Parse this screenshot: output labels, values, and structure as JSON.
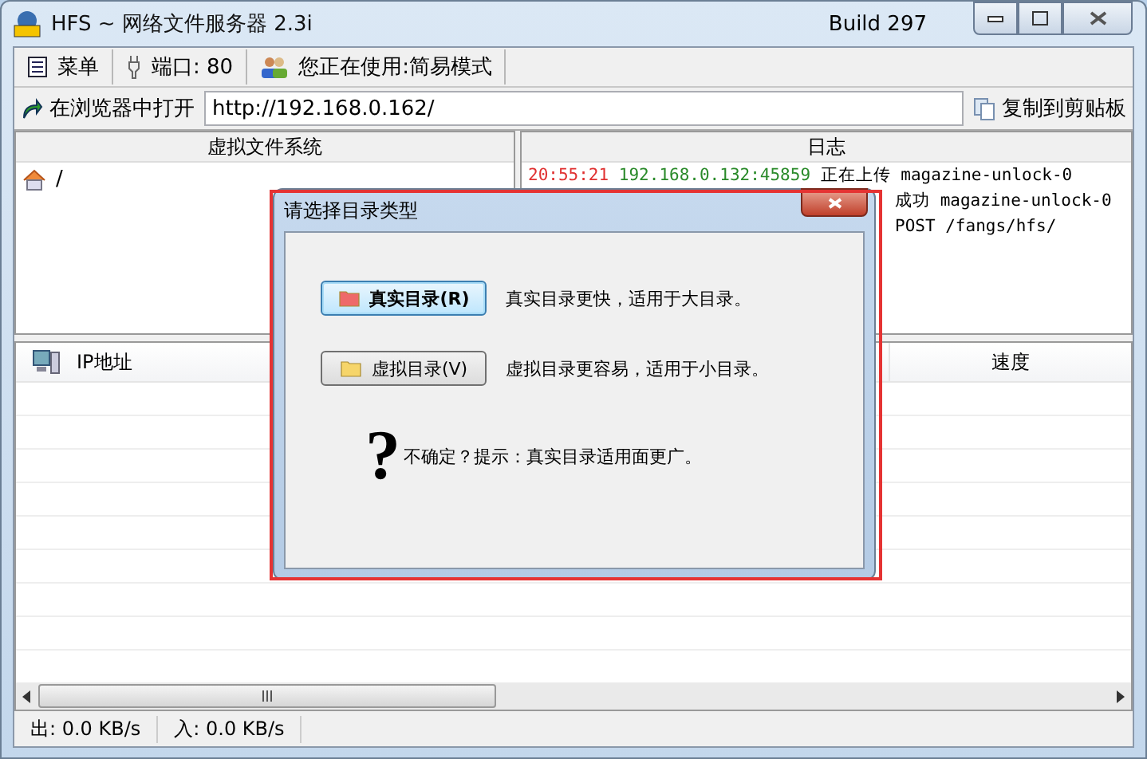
{
  "window": {
    "title": "HFS ~ 网络文件服务器 2.3i",
    "build": "Build 297"
  },
  "toolbar": [
    {
      "kind": "menu",
      "label": "菜单"
    },
    {
      "kind": "port",
      "label": "端口: 80"
    },
    {
      "kind": "mode",
      "label": "您正在使用:简易模式"
    }
  ],
  "url_bar": {
    "open_label": "在浏览器中打开",
    "url": "http://192.168.0.162/",
    "copy_label": "复制到剪贴板"
  },
  "vfs": {
    "header": "虚拟文件系统",
    "items": [
      {
        "label": "/"
      }
    ]
  },
  "log": {
    "header": "日志",
    "lines": [
      {
        "kind": "full",
        "time": "20:55:21",
        "address": "192.168.0.132:45859",
        "text": "正在上传 magazine-unlock-0"
      },
      {
        "kind": "partial",
        "text": "成功 magazine-unlock-0"
      },
      {
        "kind": "partial",
        "text": "POST /fangs/hfs/"
      }
    ]
  },
  "connections": {
    "columns": [
      "IP地址",
      "速度"
    ]
  },
  "status_bar": [
    "出: 0.0 KB/s",
    "入: 0.0 KB/s"
  ],
  "dialog": {
    "title": "请选择目录类型",
    "options": [
      {
        "kind": "real",
        "button": "真实目录(R)",
        "description": "真实目录更快，适用于大目录。",
        "selected": true
      },
      {
        "kind": "virtual",
        "button": "虚拟目录(V)",
        "description": "虚拟目录更容易，适用于小目录。",
        "selected": false
      }
    ],
    "hint_mark": "?",
    "hint": "不确定？提示：真实目录适用面更广。"
  }
}
